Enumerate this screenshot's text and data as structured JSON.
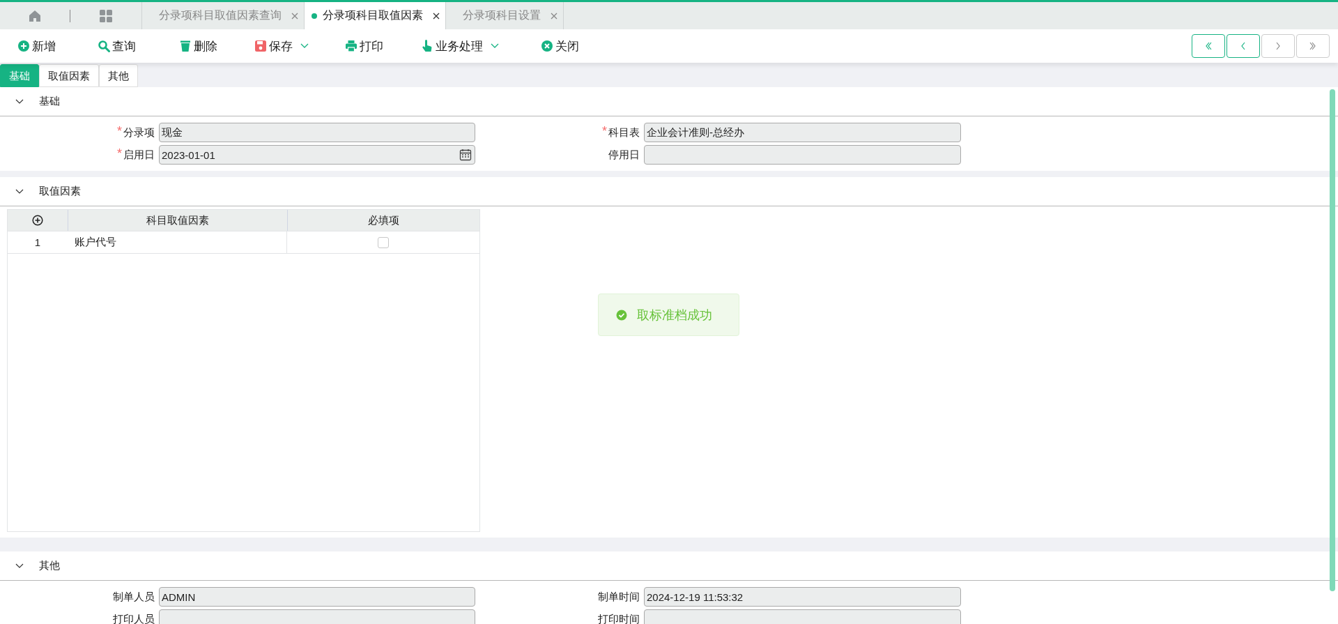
{
  "tab_bar": {
    "tabs": [
      {
        "label": "分录项科目取值因素查询",
        "selected": false
      },
      {
        "label": "分录项科目取值因素",
        "selected": true
      },
      {
        "label": "分录项科目设置",
        "selected": false
      }
    ]
  },
  "toolbar": {
    "buttons": [
      {
        "kind": "add",
        "label": "新增",
        "dropdown": false
      },
      {
        "kind": "search",
        "label": "查询",
        "dropdown": false
      },
      {
        "kind": "delete",
        "label": "删除",
        "dropdown": false
      },
      {
        "kind": "save",
        "label": "保存",
        "dropdown": true
      },
      {
        "kind": "print",
        "label": "打印",
        "dropdown": false
      },
      {
        "kind": "process",
        "label": "业务处理",
        "dropdown": true
      },
      {
        "kind": "close",
        "label": "关闭",
        "dropdown": false
      }
    ],
    "nav_buttons": [
      {
        "kind": "first",
        "disabled": false
      },
      {
        "kind": "prev",
        "disabled": false
      },
      {
        "kind": "next",
        "disabled": true
      },
      {
        "kind": "last",
        "disabled": true
      }
    ]
  },
  "sub_tabs": [
    {
      "label": "基础",
      "selected": true
    },
    {
      "label": "取值因素",
      "selected": false
    },
    {
      "label": "其他",
      "selected": false
    }
  ],
  "sections": [
    {
      "kind": "form",
      "title": "基础",
      "expanded": true,
      "fields": [
        {
          "label": "分录项",
          "required_mark": "*",
          "value": "现金",
          "kind": "text"
        },
        {
          "label": "科目表",
          "required_mark": "*",
          "value": "企业会计准则-总经办",
          "kind": "text"
        },
        {
          "label": "启用日",
          "required_mark": "*",
          "value": "2023-01-01",
          "kind": "date"
        },
        {
          "label": "停用日",
          "kind": "text"
        }
      ]
    },
    {
      "kind": "table",
      "title": "取值因素",
      "expanded": true,
      "columns": [
        "科目取值因素",
        "必填项"
      ],
      "rows": [
        {
          "index": "1",
          "factor": "账户代号",
          "checked": false
        }
      ]
    },
    {
      "kind": "form",
      "title": "其他",
      "expanded": true,
      "fields": [
        {
          "label": "制单人员",
          "value": "ADMIN",
          "kind": "text"
        },
        {
          "label": "制单时间",
          "value": "2024-12-19 11:53:32",
          "kind": "text"
        },
        {
          "label": "打印人员",
          "kind": "text"
        },
        {
          "label": "打印时间",
          "kind": "text"
        }
      ]
    }
  ],
  "toast": {
    "message": "取标准档成功"
  }
}
